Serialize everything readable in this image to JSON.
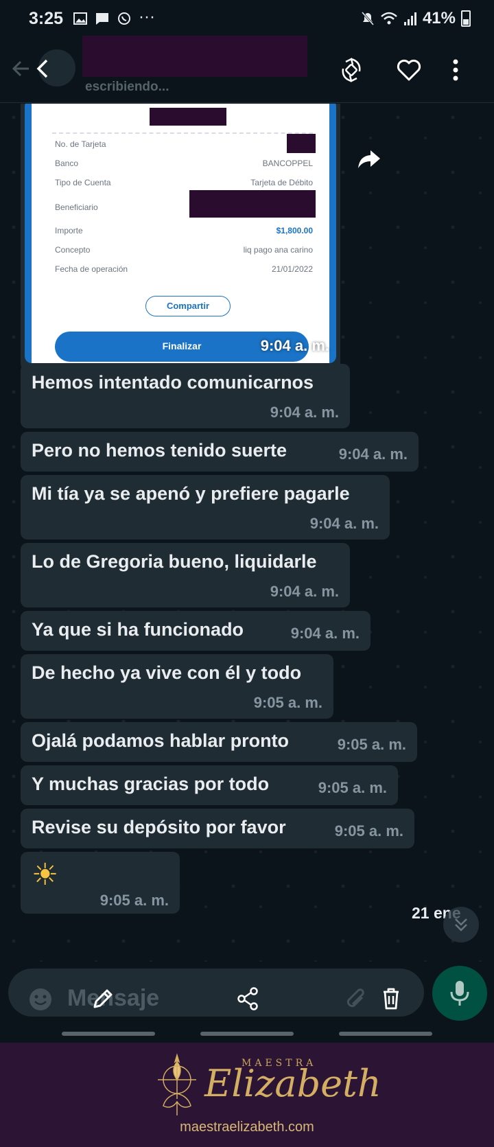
{
  "status_bar": {
    "time": "3:25",
    "notif_dots": "···",
    "battery": "41%"
  },
  "header": {
    "status": "escribiendo..."
  },
  "receipt": {
    "rows": [
      {
        "label": "No. de Tarjeta",
        "value": ""
      },
      {
        "label": "Banco",
        "value": "BANCOPPEL"
      },
      {
        "label": "Tipo de Cuenta",
        "value": "Tarjeta de Débito"
      },
      {
        "label": "Beneficiario",
        "value": ""
      },
      {
        "label": "Importe",
        "value": "$1,800.00"
      },
      {
        "label": "Concepto",
        "value": "liq pago ana carino"
      },
      {
        "label": "Fecha de operación",
        "value": "21/01/2022"
      }
    ],
    "share_label": "Compartir",
    "finish_label": "Finalizar"
  },
  "image_time": "9:04 a. m.",
  "messages": [
    {
      "text": "Hemos intentado comunicarnos",
      "time": "9:04 a. m."
    },
    {
      "text": "Pero no hemos tenido suerte",
      "time": "9:04 a. m."
    },
    {
      "text": "Mi tía ya se apenó y prefiere pagarle",
      "time": "9:04 a. m."
    },
    {
      "text": "Lo de Gregoria bueno, liquidarle",
      "time": "9:04 a. m."
    },
    {
      "text": "Ya que si ha funcionado",
      "time": "9:04 a. m."
    },
    {
      "text": "De hecho ya vive con él y todo",
      "time": "9:05 a. m."
    },
    {
      "text": "Ojalá podamos hablar pronto",
      "time": "9:05 a. m."
    },
    {
      "text": "Y muchas gracias por todo",
      "time": "9:05 a. m."
    },
    {
      "text": "Revise su depósito por favor",
      "time": "9:05 a. m."
    },
    {
      "text": "☀",
      "time": "9:05 a. m."
    }
  ],
  "date_badge": "21 ene",
  "input": {
    "placeholder": "Mensaje"
  },
  "banner": {
    "brand_top": "MAESTRA",
    "brand_name": "Elizabeth",
    "url": "maestraelizabeth.com"
  },
  "colors": {
    "background": "#0b141a",
    "bubble": "#202c33",
    "receipt_blue": "#1a73c6",
    "banner": "#2b1434",
    "gold": "#d4ae62"
  }
}
